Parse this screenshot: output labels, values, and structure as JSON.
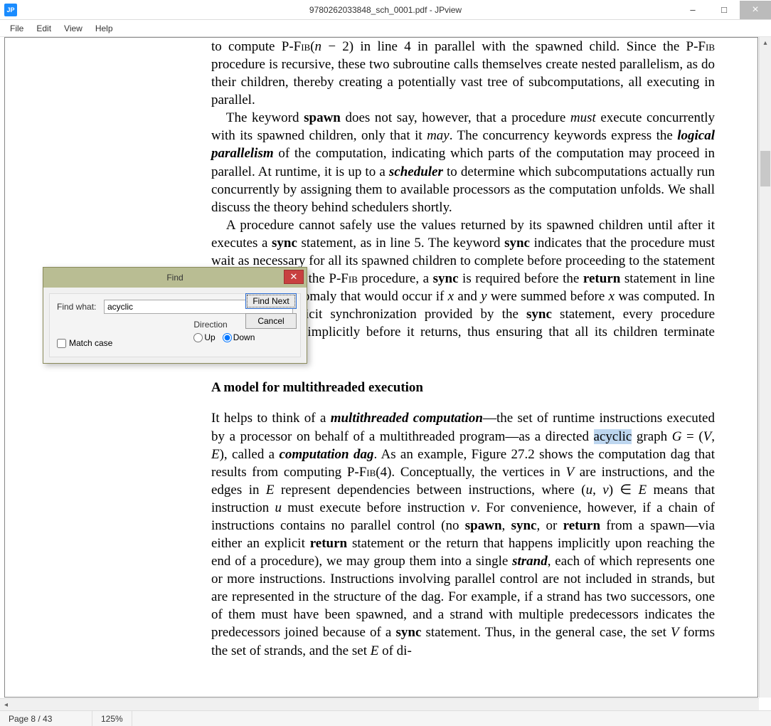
{
  "app": {
    "icon_text": "JP",
    "title": "9780262033848_sch_0001.pdf - JPview",
    "win_controls": {
      "min": "–",
      "max": "□",
      "close": "×"
    }
  },
  "menu": {
    "items": [
      "File",
      "Edit",
      "View",
      "Help"
    ]
  },
  "status": {
    "page": "Page 8 / 43",
    "zoom": "125%"
  },
  "scroll": {
    "up_glyph": "▴",
    "left_glyph": "◂"
  },
  "find": {
    "title": "Find",
    "close_glyph": "✕",
    "label": "Find what:",
    "value": "acyclic",
    "find_next": "Find Next",
    "cancel": "Cancel",
    "direction_label": "Direction",
    "up": "Up",
    "down": "Down",
    "direction_selected": "down",
    "match_case_label": "Match case",
    "match_case_checked": false
  },
  "doc": {
    "section_heading": "A model for multithreaded execution"
  }
}
